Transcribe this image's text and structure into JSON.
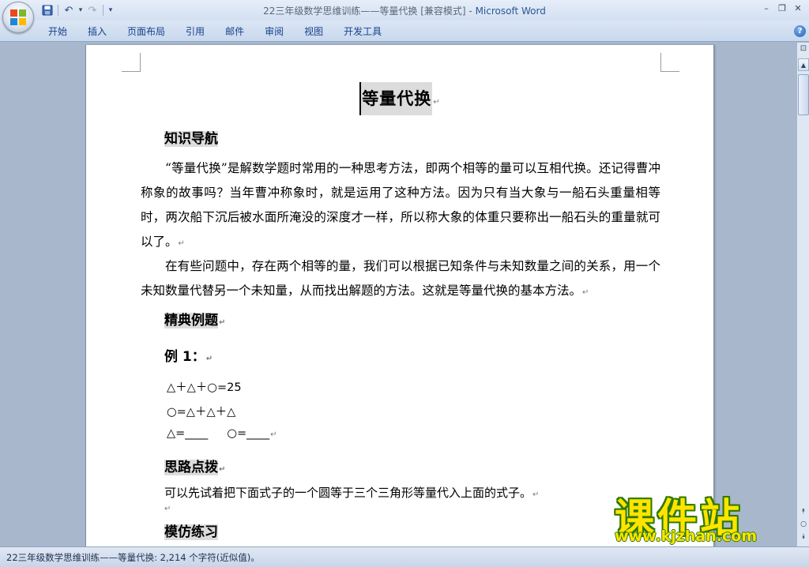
{
  "window": {
    "title_doc": "22三年级数学思维训练——等量代换 [兼容模式]",
    "title_sep": " - ",
    "title_app": "Microsoft Word",
    "controls": {
      "minimize": "–",
      "restore": "❐",
      "close": "✕"
    }
  },
  "quick_access": {
    "save": "💾",
    "undo": "↶",
    "undo_drop": "▾",
    "redo": "↷",
    "customize": "▾"
  },
  "ribbon": {
    "tabs": [
      "开始",
      "插入",
      "页面布局",
      "引用",
      "邮件",
      "审阅",
      "视图",
      "开发工具"
    ],
    "help": "?"
  },
  "document": {
    "paragraph_mark": "↵",
    "title": "等量代换",
    "sections": {
      "knowledge": "知识导航",
      "examples": "精典例题",
      "hint": "思路点拨",
      "practice": "模仿练习"
    },
    "paragraph1": "“等量代换”是解数学题时常用的一种思考方法，即两个相等的量可以互相代换。还记得曹冲称象的故事吗？当年曹冲称象时，就是运用了这种方法。因为只有当大象与一船石头重量相等时，两次船下沉后被水面所淹没的深度才一样，所以称大象的体重只要称出一船石头的重量就可以了。",
    "paragraph2": "在有些问题中，存在两个相等的量，我们可以根据已知条件与未知数量之间的关系，用一个未知数量代替另一个未知量，从而找出解题的方法。这就是等量代换的基本方法。",
    "example1_label": "例 1：",
    "eq1": "△＋△＋○=25",
    "eq2": "○=△＋△＋△",
    "eq3a": "△=____",
    "eq3b": "○=____",
    "hint_text": "可以先试着把下面式子的一个圆等于三个三角形等量代入上面的式子。"
  },
  "scrollbar": {
    "ruler": "⊡",
    "up": "▲",
    "prev": "⯭",
    "select": "○",
    "next": "⯯"
  },
  "status": {
    "text": "22三年级数学思维训练——等量代换: 2,214 个字符(近似值)。"
  },
  "watermark": {
    "name": "课件站",
    "url": "www.kjzhan.com"
  }
}
